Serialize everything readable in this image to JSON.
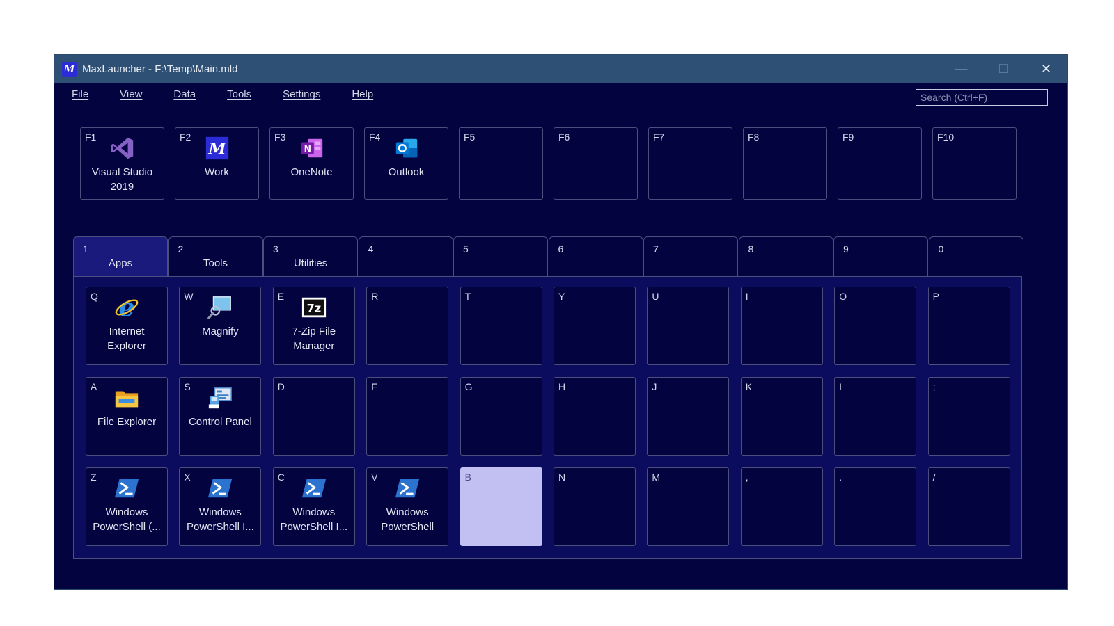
{
  "window": {
    "title": "MaxLauncher - F:\\Temp\\Main.mld",
    "app_icon": "M",
    "controls": {
      "minimize": "—",
      "maximize": "☐",
      "close": "✕"
    }
  },
  "menu": [
    "File",
    "View",
    "Data",
    "Tools",
    "Settings",
    "Help"
  ],
  "search": {
    "placeholder": "Search (Ctrl+F)",
    "value": ""
  },
  "fkeys": [
    {
      "key": "F1",
      "label": "Visual Studio\n2019",
      "icon": "visual-studio"
    },
    {
      "key": "F2",
      "label": "Work",
      "icon": "maxlauncher"
    },
    {
      "key": "F3",
      "label": "OneNote",
      "icon": "onenote"
    },
    {
      "key": "F4",
      "label": "Outlook",
      "icon": "outlook"
    },
    {
      "key": "F5",
      "label": "",
      "icon": ""
    },
    {
      "key": "F6",
      "label": "",
      "icon": ""
    },
    {
      "key": "F7",
      "label": "",
      "icon": ""
    },
    {
      "key": "F8",
      "label": "",
      "icon": ""
    },
    {
      "key": "F9",
      "label": "",
      "icon": ""
    },
    {
      "key": "F10",
      "label": "",
      "icon": ""
    }
  ],
  "tabs": [
    {
      "num": "1",
      "label": "Apps",
      "active": true
    },
    {
      "num": "2",
      "label": "Tools"
    },
    {
      "num": "3",
      "label": "Utilities"
    },
    {
      "num": "4",
      "label": ""
    },
    {
      "num": "5",
      "label": ""
    },
    {
      "num": "6",
      "label": ""
    },
    {
      "num": "7",
      "label": ""
    },
    {
      "num": "8",
      "label": ""
    },
    {
      "num": "9",
      "label": ""
    },
    {
      "num": "0",
      "label": ""
    }
  ],
  "grid": [
    [
      {
        "key": "Q",
        "label": "Internet\nExplorer",
        "icon": "internet-explorer"
      },
      {
        "key": "W",
        "label": "Magnify",
        "icon": "magnify"
      },
      {
        "key": "E",
        "label": "7-Zip File\nManager",
        "icon": "7zip"
      },
      {
        "key": "R",
        "label": "",
        "icon": ""
      },
      {
        "key": "T",
        "label": "",
        "icon": ""
      },
      {
        "key": "Y",
        "label": "",
        "icon": ""
      },
      {
        "key": "U",
        "label": "",
        "icon": ""
      },
      {
        "key": "I",
        "label": "",
        "icon": ""
      },
      {
        "key": "O",
        "label": "",
        "icon": ""
      },
      {
        "key": "P",
        "label": "",
        "icon": ""
      }
    ],
    [
      {
        "key": "A",
        "label": "File Explorer",
        "icon": "file-explorer"
      },
      {
        "key": "S",
        "label": "Control Panel",
        "icon": "control-panel"
      },
      {
        "key": "D",
        "label": "",
        "icon": ""
      },
      {
        "key": "F",
        "label": "",
        "icon": ""
      },
      {
        "key": "G",
        "label": "",
        "icon": ""
      },
      {
        "key": "H",
        "label": "",
        "icon": ""
      },
      {
        "key": "J",
        "label": "",
        "icon": ""
      },
      {
        "key": "K",
        "label": "",
        "icon": ""
      },
      {
        "key": "L",
        "label": "",
        "icon": ""
      },
      {
        "key": ";",
        "label": "",
        "icon": ""
      }
    ],
    [
      {
        "key": "Z",
        "label": "Windows\nPowerShell (...",
        "icon": "powershell"
      },
      {
        "key": "X",
        "label": "Windows\nPowerShell I...",
        "icon": "powershell"
      },
      {
        "key": "C",
        "label": "Windows\nPowerShell I...",
        "icon": "powershell"
      },
      {
        "key": "V",
        "label": "Windows\nPowerShell",
        "icon": "powershell"
      },
      {
        "key": "B",
        "label": "",
        "icon": "",
        "selected": true
      },
      {
        "key": "N",
        "label": "",
        "icon": ""
      },
      {
        "key": "M",
        "label": "",
        "icon": ""
      },
      {
        "key": ",",
        "label": "",
        "icon": ""
      },
      {
        "key": ".",
        "label": "",
        "icon": ""
      },
      {
        "key": "/",
        "label": "",
        "icon": ""
      }
    ]
  ]
}
